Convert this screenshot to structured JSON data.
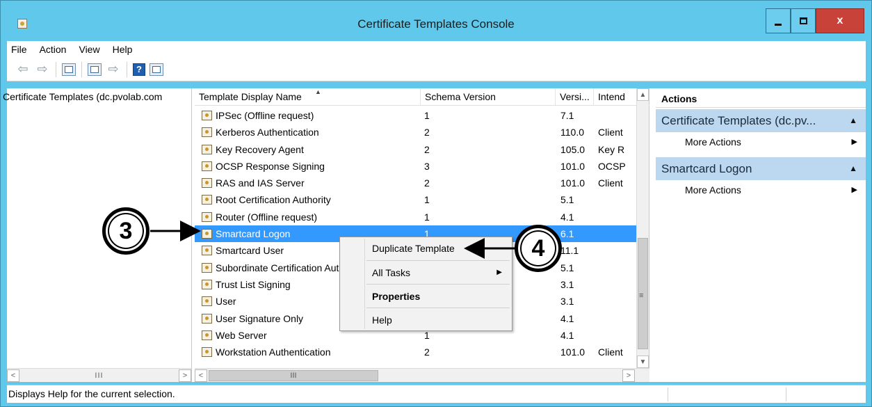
{
  "window": {
    "title": "Certificate Templates Console",
    "title_bar_color": "#60c8ea",
    "close_color": "#c9423a",
    "close_label": "x"
  },
  "menubar": {
    "items": [
      "File",
      "Action",
      "View",
      "Help"
    ]
  },
  "toolbar": {
    "icons": [
      "back-arrow-icon",
      "forward-arrow-icon",
      "show-hide-console-tree-icon",
      "properties-icon",
      "export-list-icon",
      "help-icon",
      "show-action-pane-icon"
    ]
  },
  "left_pane": {
    "tree_root": "Certificate Templates (dc.pvolab.com",
    "scroll_grip": "III"
  },
  "center_pane": {
    "columns": [
      "Template Display Name",
      "Schema Version",
      "Versi...",
      "Intend"
    ],
    "rows": [
      {
        "name": "IPSec (Offline request)",
        "schema": "1",
        "version": "7.1",
        "intended": ""
      },
      {
        "name": "Kerberos Authentication",
        "schema": "2",
        "version": "110.0",
        "intended": "Client"
      },
      {
        "name": "Key Recovery Agent",
        "schema": "2",
        "version": "105.0",
        "intended": "Key R"
      },
      {
        "name": "OCSP Response Signing",
        "schema": "3",
        "version": "101.0",
        "intended": "OCSP"
      },
      {
        "name": "RAS and IAS Server",
        "schema": "2",
        "version": "101.0",
        "intended": "Client"
      },
      {
        "name": "Root Certification Authority",
        "schema": "1",
        "version": "5.1",
        "intended": ""
      },
      {
        "name": "Router (Offline request)",
        "schema": "1",
        "version": "4.1",
        "intended": ""
      },
      {
        "name": "Smartcard Logon",
        "schema": "1",
        "version": "6.1",
        "intended": ""
      },
      {
        "name": "Smartcard User",
        "schema": "",
        "version": "11.1",
        "intended": ""
      },
      {
        "name": "Subordinate Certification Authority",
        "schema": "",
        "version": "5.1",
        "intended": ""
      },
      {
        "name": "Trust List Signing",
        "schema": "",
        "version": "3.1",
        "intended": ""
      },
      {
        "name": "User",
        "schema": "",
        "version": "3.1",
        "intended": ""
      },
      {
        "name": "User Signature Only",
        "schema": "",
        "version": "4.1",
        "intended": ""
      },
      {
        "name": "Web Server",
        "schema": "1",
        "version": "4.1",
        "intended": ""
      },
      {
        "name": "Workstation Authentication",
        "schema": "2",
        "version": "101.0",
        "intended": "Client"
      }
    ],
    "selected_index": 7,
    "selection_color": "#3399ff",
    "scroll_grip": "III",
    "vscroll_grip": "≡"
  },
  "context_menu": {
    "items": [
      "Duplicate Template",
      "All Tasks",
      "Properties",
      "Help"
    ]
  },
  "actions_pane": {
    "title": "Actions",
    "sections": [
      {
        "header": "Certificate Templates (dc.pv...",
        "item": "More Actions"
      },
      {
        "header": "Smartcard Logon",
        "item": "More Actions"
      }
    ],
    "section_color": "#bcd8f0"
  },
  "status": {
    "text": "Displays Help for the current selection."
  },
  "callouts": {
    "step3": "3",
    "step4": "4"
  }
}
